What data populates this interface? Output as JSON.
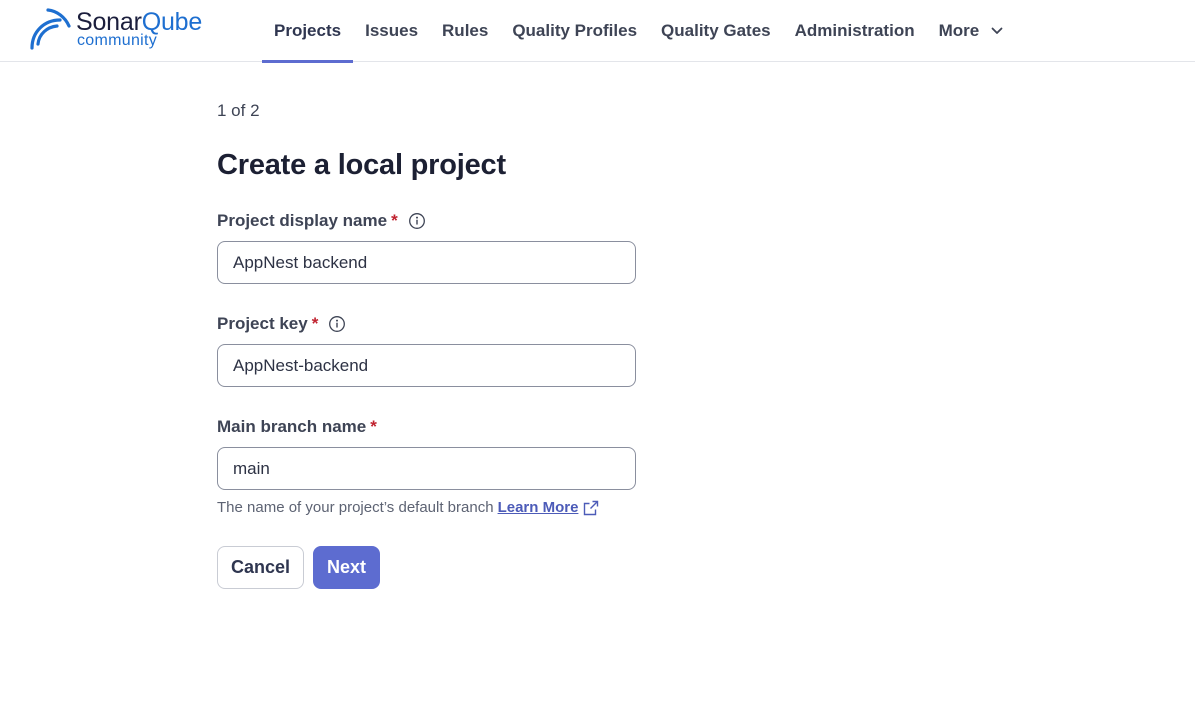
{
  "brand": {
    "name_part1": "Sonar",
    "name_part2": "Qube",
    "edition": "community"
  },
  "nav": {
    "items": [
      {
        "label": "Projects",
        "active": true
      },
      {
        "label": "Issues"
      },
      {
        "label": "Rules"
      },
      {
        "label": "Quality Profiles"
      },
      {
        "label": "Quality Gates"
      },
      {
        "label": "Administration"
      },
      {
        "label": "More"
      }
    ]
  },
  "page": {
    "step": "1 of 2",
    "title": "Create a local project"
  },
  "form": {
    "display_name": {
      "label": "Project display name",
      "required_mark": "*",
      "value": "AppNest backend"
    },
    "project_key": {
      "label": "Project key",
      "required_mark": "*",
      "value": "AppNest-backend"
    },
    "main_branch": {
      "label": "Main branch name",
      "required_mark": "*",
      "value": "main",
      "help_text": "The name of your project’s default branch",
      "help_link": "Learn More"
    }
  },
  "actions": {
    "cancel_label": "Cancel",
    "next_label": "Next"
  },
  "colors": {
    "accent": "#5d6cd0",
    "brand_blue": "#1e6fd0",
    "required": "#c0222f"
  },
  "icons": [
    "sonarqube-logo-icon",
    "chevron-down-icon",
    "info-icon",
    "external-link-icon"
  ]
}
